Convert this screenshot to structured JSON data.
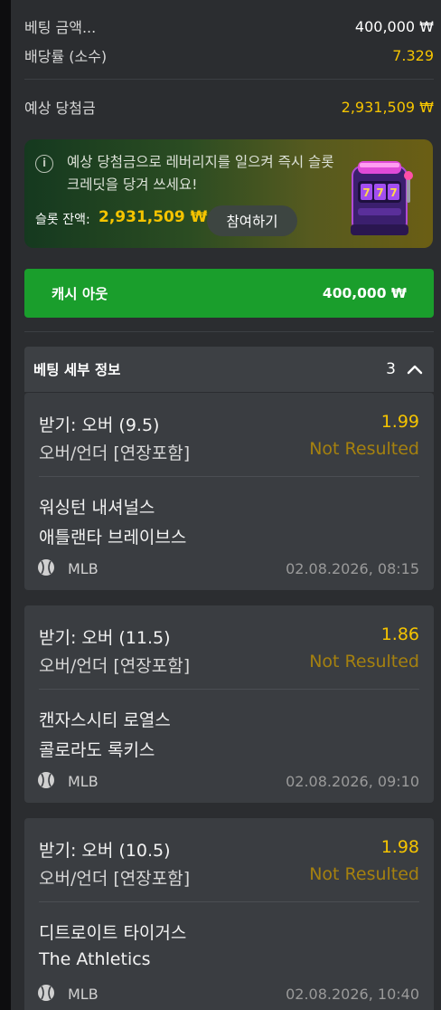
{
  "summary": {
    "stake_label": "베팅 금액...",
    "stake_value": "400,000 ₩",
    "odds_label": "배당률 (소수)",
    "odds_value": "7.329",
    "win_label": "예상 당첨금",
    "win_value": "2,931,509 ₩"
  },
  "promo": {
    "message": "예상 당첨금으로 레버리지를 일으켜 즉시 슬롯 크레딧을 당겨 쓰세요!",
    "balance_label": "슬롯 잔액:",
    "balance_value": "2,931,509 ₩",
    "join_button": "참여하기",
    "icon": "slot-machine-icon"
  },
  "cashout": {
    "label": "캐시 아웃",
    "value": "400,000 ₩"
  },
  "details": {
    "title": "베팅 세부 정보",
    "count": "3",
    "icon": "chevron-up-icon"
  },
  "bets": [
    {
      "selection": "받기: 오버 (9.5)",
      "odds": "1.99",
      "market": "오버/언더 [연장포함]",
      "status": "Not Resulted",
      "team1": "워싱턴 내셔널스",
      "team2": "애틀랜타 브레이브스",
      "league": "MLB",
      "datetime": "02.08.2026, 08:15"
    },
    {
      "selection": "받기: 오버 (11.5)",
      "odds": "1.86",
      "market": "오버/언더 [연장포함]",
      "status": "Not Resulted",
      "team1": "캔자스시티 로열스",
      "team2": "콜로라도 록키스",
      "league": "MLB",
      "datetime": "02.08.2026, 09:10"
    },
    {
      "selection": "받기: 오버 (10.5)",
      "odds": "1.98",
      "market": "오버/언더 [연장포함]",
      "status": "Not Resulted",
      "team1": "디트로이트 타이거스",
      "team2": "The Athletics",
      "league": "MLB",
      "datetime": "02.08.2026, 10:40"
    }
  ],
  "colors": {
    "accent_yellow": "#f5c400",
    "cashout_green": "#1a9e2c",
    "status_dim_yellow": "#a5810f",
    "panel_bg": "#2b2d30",
    "card_bg": "#3a3d41"
  }
}
